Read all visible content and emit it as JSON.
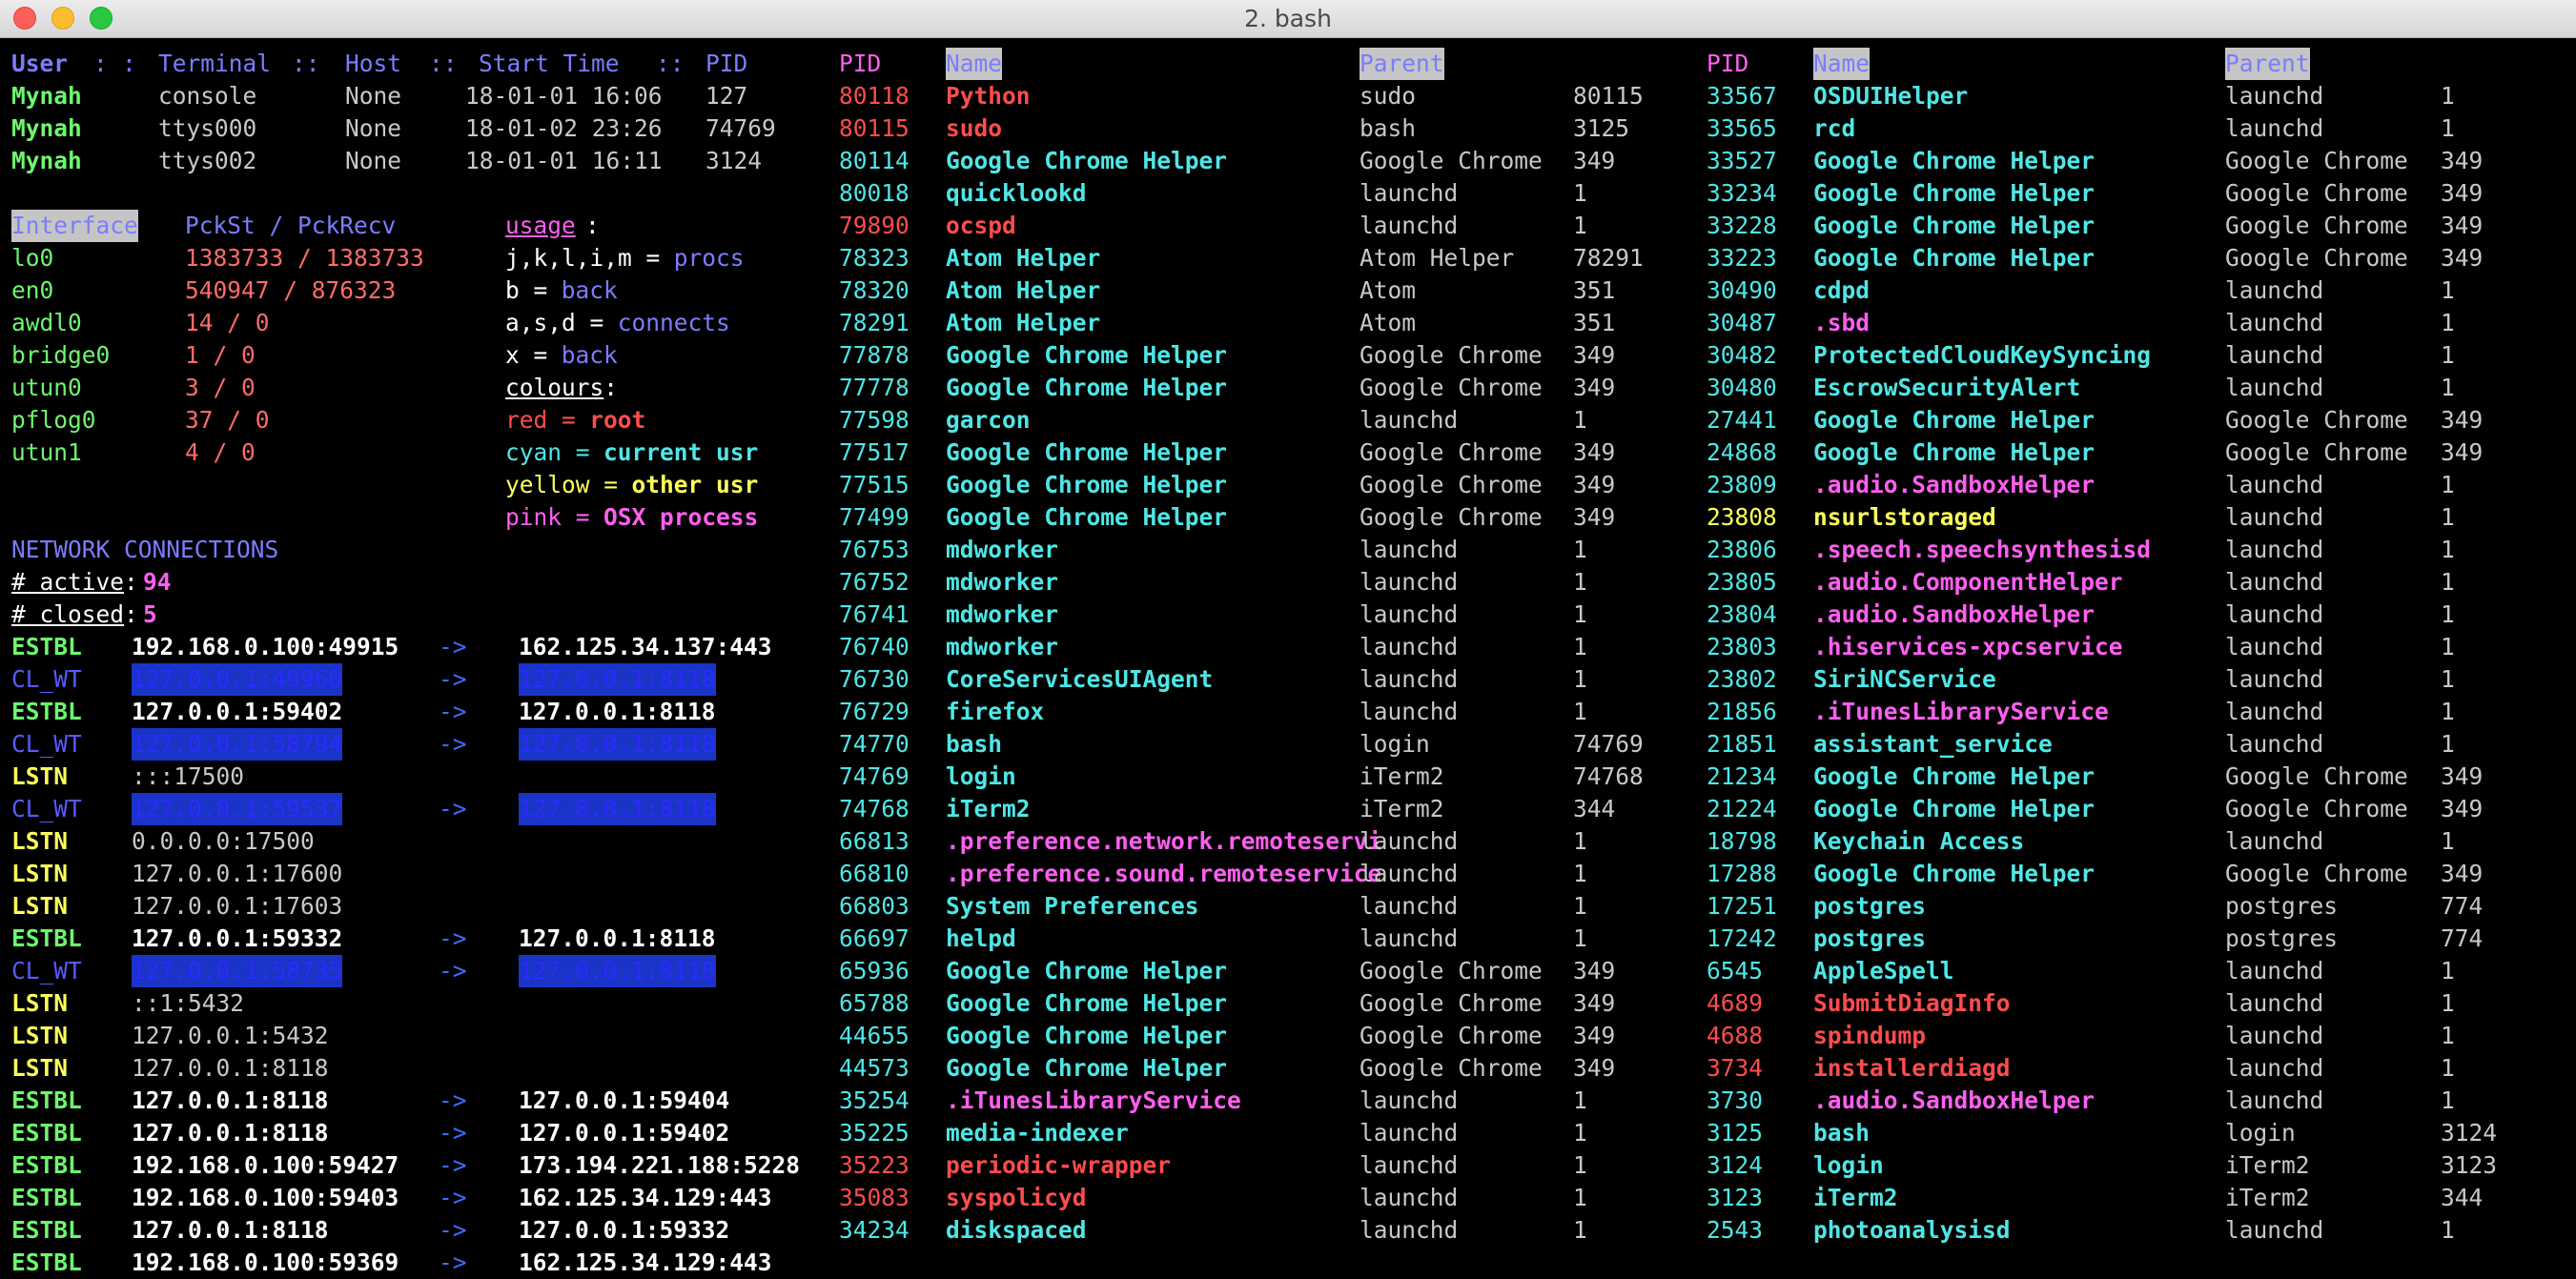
{
  "window": {
    "title": "2. bash"
  },
  "users": {
    "headers": [
      "User",
      ":",
      ":",
      "Terminal",
      "::",
      "Host",
      "::",
      "Start Time",
      "::",
      "PID"
    ],
    "rows": [
      [
        "Mynah",
        "console",
        "None",
        "18-01-01 16:06",
        "127"
      ],
      [
        "Mynah",
        "ttys000",
        "None",
        "18-01-02 23:26",
        "74769"
      ],
      [
        "Mynah",
        "ttys002",
        "None",
        "18-01-01 16:11",
        "3124"
      ]
    ]
  },
  "interfaces": {
    "header_name": "Interface",
    "header_stats": "PckSt / PckRecv",
    "rows": [
      [
        "lo0",
        "1383733 / 1383733"
      ],
      [
        "en0",
        "540947 / 876323"
      ],
      [
        "awdl0",
        "14 / 0"
      ],
      [
        "bridge0",
        "1 / 0"
      ],
      [
        "utun0",
        "3 / 0"
      ],
      [
        "pflog0",
        "37 / 0"
      ],
      [
        "utun1",
        "4 / 0"
      ]
    ]
  },
  "usage": {
    "title": "usage",
    "colon": ":",
    "lines": [
      [
        "j,k,l,i,m",
        " = ",
        "procs"
      ],
      [
        "b",
        " = ",
        "back"
      ],
      [
        "a,s,d",
        " = ",
        "connects"
      ],
      [
        "x",
        " = ",
        "back"
      ]
    ],
    "colours_title": "colours",
    "colours": [
      [
        "red",
        " = ",
        "root"
      ],
      [
        "cyan",
        " = ",
        "current usr"
      ],
      [
        "yellow",
        " = ",
        "other usr"
      ],
      [
        "pink",
        " = ",
        "OSX process"
      ]
    ]
  },
  "network": {
    "title": "NETWORK CONNECTIONS",
    "active_label": "# active",
    "active_count": "94",
    "closed_label": "# closed",
    "closed_count": "5",
    "sep": ":",
    "arrow": "->",
    "rows": [
      [
        "ESTBL",
        "192.168.0.100:49915",
        "162.125.34.137:443"
      ],
      [
        "CL_WT",
        "127.0.0.1:49960",
        "127.0.0.1:8118"
      ],
      [
        "ESTBL",
        "127.0.0.1:59402",
        "127.0.0.1:8118"
      ],
      [
        "CL_WT",
        "127.0.0.1:58794",
        "127.0.0.1:8118"
      ],
      [
        "LSTN",
        ":::17500",
        ""
      ],
      [
        "CL_WT",
        "127.0.0.1:59537",
        "127.0.0.1:8118"
      ],
      [
        "LSTN",
        "0.0.0.0:17500",
        ""
      ],
      [
        "LSTN",
        "127.0.0.1:17600",
        ""
      ],
      [
        "LSTN",
        "127.0.0.1:17603",
        ""
      ],
      [
        "ESTBL",
        "127.0.0.1:59332",
        "127.0.0.1:8118"
      ],
      [
        "CL_WT",
        "127.0.0.1:58735",
        "127.0.0.1:8118"
      ],
      [
        "LSTN",
        "::1:5432",
        ""
      ],
      [
        "LSTN",
        "127.0.0.1:5432",
        ""
      ],
      [
        "LSTN",
        "127.0.0.1:8118",
        ""
      ],
      [
        "ESTBL",
        "127.0.0.1:8118",
        "127.0.0.1:59404"
      ],
      [
        "ESTBL",
        "127.0.0.1:8118",
        "127.0.0.1:59402"
      ],
      [
        "ESTBL",
        "192.168.0.100:59427",
        "173.194.221.188:5228"
      ],
      [
        "ESTBL",
        "192.168.0.100:59403",
        "162.125.34.129:443"
      ],
      [
        "ESTBL",
        "127.0.0.1:8118",
        "127.0.0.1:59332"
      ],
      [
        "ESTBL",
        "192.168.0.100:59369",
        "162.125.34.129:443"
      ]
    ]
  },
  "proc_headers": {
    "pid": "PID",
    "name": "Name",
    "parent": "Parent"
  },
  "procs_left": [
    [
      "80118",
      "Python",
      "sudo",
      "80115",
      "r"
    ],
    [
      "80115",
      "sudo",
      "bash",
      "3125",
      "r"
    ],
    [
      "80114",
      "Google Chrome Helper",
      "Google Chrome",
      "349",
      "c"
    ],
    [
      "80018",
      "quicklookd",
      "launchd",
      "1",
      "c"
    ],
    [
      "79890",
      "ocspd",
      "launchd",
      "1",
      "r"
    ],
    [
      "78323",
      "Atom Helper",
      "Atom Helper",
      "78291",
      "c"
    ],
    [
      "78320",
      "Atom Helper",
      "Atom",
      "351",
      "c"
    ],
    [
      "78291",
      "Atom Helper",
      "Atom",
      "351",
      "c"
    ],
    [
      "77878",
      "Google Chrome Helper",
      "Google Chrome",
      "349",
      "c"
    ],
    [
      "77778",
      "Google Chrome Helper",
      "Google Chrome",
      "349",
      "c"
    ],
    [
      "77598",
      "garcon",
      "launchd",
      "1",
      "c"
    ],
    [
      "77517",
      "Google Chrome Helper",
      "Google Chrome",
      "349",
      "c"
    ],
    [
      "77515",
      "Google Chrome Helper",
      "Google Chrome",
      "349",
      "c"
    ],
    [
      "77499",
      "Google Chrome Helper",
      "Google Chrome",
      "349",
      "c"
    ],
    [
      "76753",
      "mdworker",
      "launchd",
      "1",
      "c"
    ],
    [
      "76752",
      "mdworker",
      "launchd",
      "1",
      "c"
    ],
    [
      "76741",
      "mdworker",
      "launchd",
      "1",
      "c"
    ],
    [
      "76740",
      "mdworker",
      "launchd",
      "1",
      "c"
    ],
    [
      "76730",
      "CoreServicesUIAgent",
      "launchd",
      "1",
      "c"
    ],
    [
      "76729",
      "firefox",
      "launchd",
      "1",
      "c"
    ],
    [
      "74770",
      "bash",
      "login",
      "74769",
      "c"
    ],
    [
      "74769",
      "login",
      "iTerm2",
      "74768",
      "c"
    ],
    [
      "74768",
      "iTerm2",
      "iTerm2",
      "344",
      "c"
    ],
    [
      "66813",
      ".preference.network.remoteservi",
      "launchd",
      "1",
      "p"
    ],
    [
      "66810",
      ".preference.sound.remoteservice",
      "launchd",
      "1",
      "p"
    ],
    [
      "66803",
      "System Preferences",
      "launchd",
      "1",
      "c"
    ],
    [
      "66697",
      "helpd",
      "launchd",
      "1",
      "c"
    ],
    [
      "65936",
      "Google Chrome Helper",
      "Google Chrome",
      "349",
      "c"
    ],
    [
      "65788",
      "Google Chrome Helper",
      "Google Chrome",
      "349",
      "c"
    ],
    [
      "44655",
      "Google Chrome Helper",
      "Google Chrome",
      "349",
      "c"
    ],
    [
      "44573",
      "Google Chrome Helper",
      "Google Chrome",
      "349",
      "c"
    ],
    [
      "35254",
      ".iTunesLibraryService",
      "launchd",
      "1",
      "p"
    ],
    [
      "35225",
      "media-indexer",
      "launchd",
      "1",
      "c"
    ],
    [
      "35223",
      "periodic-wrapper",
      "launchd",
      "1",
      "r"
    ],
    [
      "35083",
      "syspolicyd",
      "launchd",
      "1",
      "r"
    ],
    [
      "34234",
      "diskspaced",
      "launchd",
      "1",
      "c"
    ]
  ],
  "procs_right": [
    [
      "33567",
      "OSDUIHelper",
      "launchd",
      "1",
      "c"
    ],
    [
      "33565",
      "rcd",
      "launchd",
      "1",
      "c"
    ],
    [
      "33527",
      "Google Chrome Helper",
      "Google Chrome",
      "349",
      "c"
    ],
    [
      "33234",
      "Google Chrome Helper",
      "Google Chrome",
      "349",
      "c"
    ],
    [
      "33228",
      "Google Chrome Helper",
      "Google Chrome",
      "349",
      "c"
    ],
    [
      "33223",
      "Google Chrome Helper",
      "Google Chrome",
      "349",
      "c"
    ],
    [
      "30490",
      "cdpd",
      "launchd",
      "1",
      "c"
    ],
    [
      "30487",
      ".sbd",
      "launchd",
      "1",
      "p"
    ],
    [
      "30482",
      "ProtectedCloudKeySyncing",
      "launchd",
      "1",
      "c"
    ],
    [
      "30480",
      "EscrowSecurityAlert",
      "launchd",
      "1",
      "c"
    ],
    [
      "27441",
      "Google Chrome Helper",
      "Google Chrome",
      "349",
      "c"
    ],
    [
      "24868",
      "Google Chrome Helper",
      "Google Chrome",
      "349",
      "c"
    ],
    [
      "23809",
      ".audio.SandboxHelper",
      "launchd",
      "1",
      "p"
    ],
    [
      "23808",
      "nsurlstoraged",
      "launchd",
      "1",
      "y"
    ],
    [
      "23806",
      ".speech.speechsynthesisd",
      "launchd",
      "1",
      "p"
    ],
    [
      "23805",
      ".audio.ComponentHelper",
      "launchd",
      "1",
      "p"
    ],
    [
      "23804",
      ".audio.SandboxHelper",
      "launchd",
      "1",
      "p"
    ],
    [
      "23803",
      ".hiservices-xpcservice",
      "launchd",
      "1",
      "p"
    ],
    [
      "23802",
      "SiriNCService",
      "launchd",
      "1",
      "c"
    ],
    [
      "21856",
      ".iTunesLibraryService",
      "launchd",
      "1",
      "p"
    ],
    [
      "21851",
      "assistant_service",
      "launchd",
      "1",
      "c"
    ],
    [
      "21234",
      "Google Chrome Helper",
      "Google Chrome",
      "349",
      "c"
    ],
    [
      "21224",
      "Google Chrome Helper",
      "Google Chrome",
      "349",
      "c"
    ],
    [
      "18798",
      "Keychain Access",
      "launchd",
      "1",
      "c"
    ],
    [
      "17288",
      "Google Chrome Helper",
      "Google Chrome",
      "349",
      "c"
    ],
    [
      "17251",
      "postgres",
      "postgres",
      "774",
      "c"
    ],
    [
      "17242",
      "postgres",
      "postgres",
      "774",
      "c"
    ],
    [
      "6545",
      "AppleSpell",
      "launchd",
      "1",
      "c"
    ],
    [
      "4689",
      "SubmitDiagInfo",
      "launchd",
      "1",
      "r"
    ],
    [
      "4688",
      "spindump",
      "launchd",
      "1",
      "r"
    ],
    [
      "3734",
      "installerdiagd",
      "launchd",
      "1",
      "r"
    ],
    [
      "3730",
      ".audio.SandboxHelper",
      "launchd",
      "1",
      "p"
    ],
    [
      "3125",
      "bash",
      "login",
      "3124",
      "c"
    ],
    [
      "3124",
      "login",
      "iTerm2",
      "3123",
      "c"
    ],
    [
      "3123",
      "iTerm2",
      "iTerm2",
      "344",
      "c"
    ],
    [
      "2543",
      "photoanalysisd",
      "launchd",
      "1",
      "c"
    ]
  ],
  "colors": {
    "red": "#ff4c4c",
    "cyan": "#4fe6e6",
    "yellow": "#ffff5a",
    "pink": "#ff5ff0",
    "green": "#6df76d",
    "blue": "#7c7cff",
    "white": "#ffffff",
    "gray": "#c8c8c8",
    "salmon": "#ff6b6b",
    "selblue": "#1a34c7"
  }
}
